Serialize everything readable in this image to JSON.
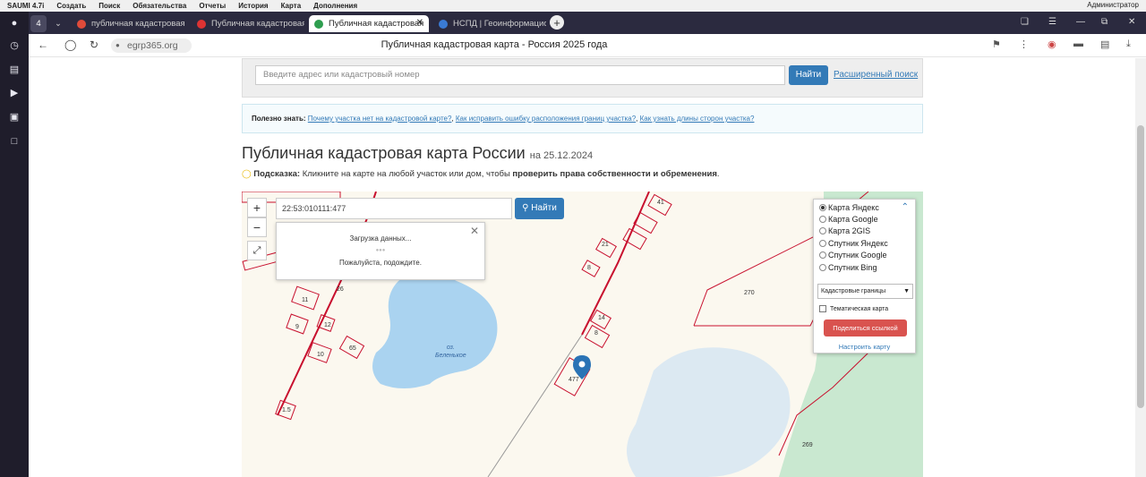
{
  "menubar": {
    "items": [
      "SAUMI 4.7i",
      "Создать",
      "Поиск",
      "Обязательства",
      "Отчеты",
      "История",
      "Карта",
      "Дополнения"
    ],
    "user": "Администратор"
  },
  "tabs": [
    {
      "label": "публичная кадастровая к",
      "favicon_color": "#e04b3a"
    },
    {
      "label": "Публичная кадастровая",
      "favicon_color": "#d33"
    },
    {
      "label": "Публичная кадастровая",
      "favicon_color": "#2e9e4f"
    },
    {
      "label": "НСПД | Геоинформацион",
      "favicon_color": "#3a7bd5"
    }
  ],
  "tab_counter": "4",
  "address": {
    "url": "egrp365.org",
    "page_title": "Публичная кадастровая карта - Россия 2025 года"
  },
  "search": {
    "placeholder": "Введите адрес или кадастровый номер",
    "button": "Найти",
    "advanced": "Расширенный поиск"
  },
  "tip": {
    "label": "Полезно знать:",
    "links": [
      "Почему участка нет на кадастровой карте?",
      "Как исправить ошибку расположения границ участка?",
      "Как узнать длины сторон участка?"
    ]
  },
  "heading": {
    "title": "Публичная кадастровая карта России",
    "date": "на 25.12.2024"
  },
  "hint": {
    "label": "Подсказка:",
    "text": "Кликните на карте на любой участок или дом, чтобы",
    "bold": "проверить права собственности и обременения",
    "end": "."
  },
  "map": {
    "cadastral_number": "22:53:010111:477",
    "find_button": "Найти",
    "zoom_in": "+",
    "zoom_out": "−",
    "loading_title": "Загрузка данных...",
    "loading_wait": "Пожалуйста, подождите.",
    "layers": [
      "Карта Яндекс",
      "Карта Google",
      "Карта 2GIS",
      "Спутник Яндекс",
      "Спутник Google",
      "Спутник Bing"
    ],
    "selected_layer": "Карта Яндекс",
    "overlay_select": "Кадастровые границы",
    "thematic": "Тематическая карта",
    "share_button": "Поделиться ссылкой",
    "configure": "Настроить карту",
    "lake_name": "оз.\nБеленькое",
    "parcel_labels": [
      "41",
      "21",
      "8",
      "14",
      "8",
      "477",
      "11",
      "9",
      "12",
      "10",
      "65",
      "26",
      "1.5",
      "270",
      "269"
    ]
  },
  "colors": {
    "primary": "#337ab7",
    "danger": "#d9534f",
    "water": "#aad3f0",
    "forest": "#c9e8d0",
    "parcel": "#c8102e"
  }
}
